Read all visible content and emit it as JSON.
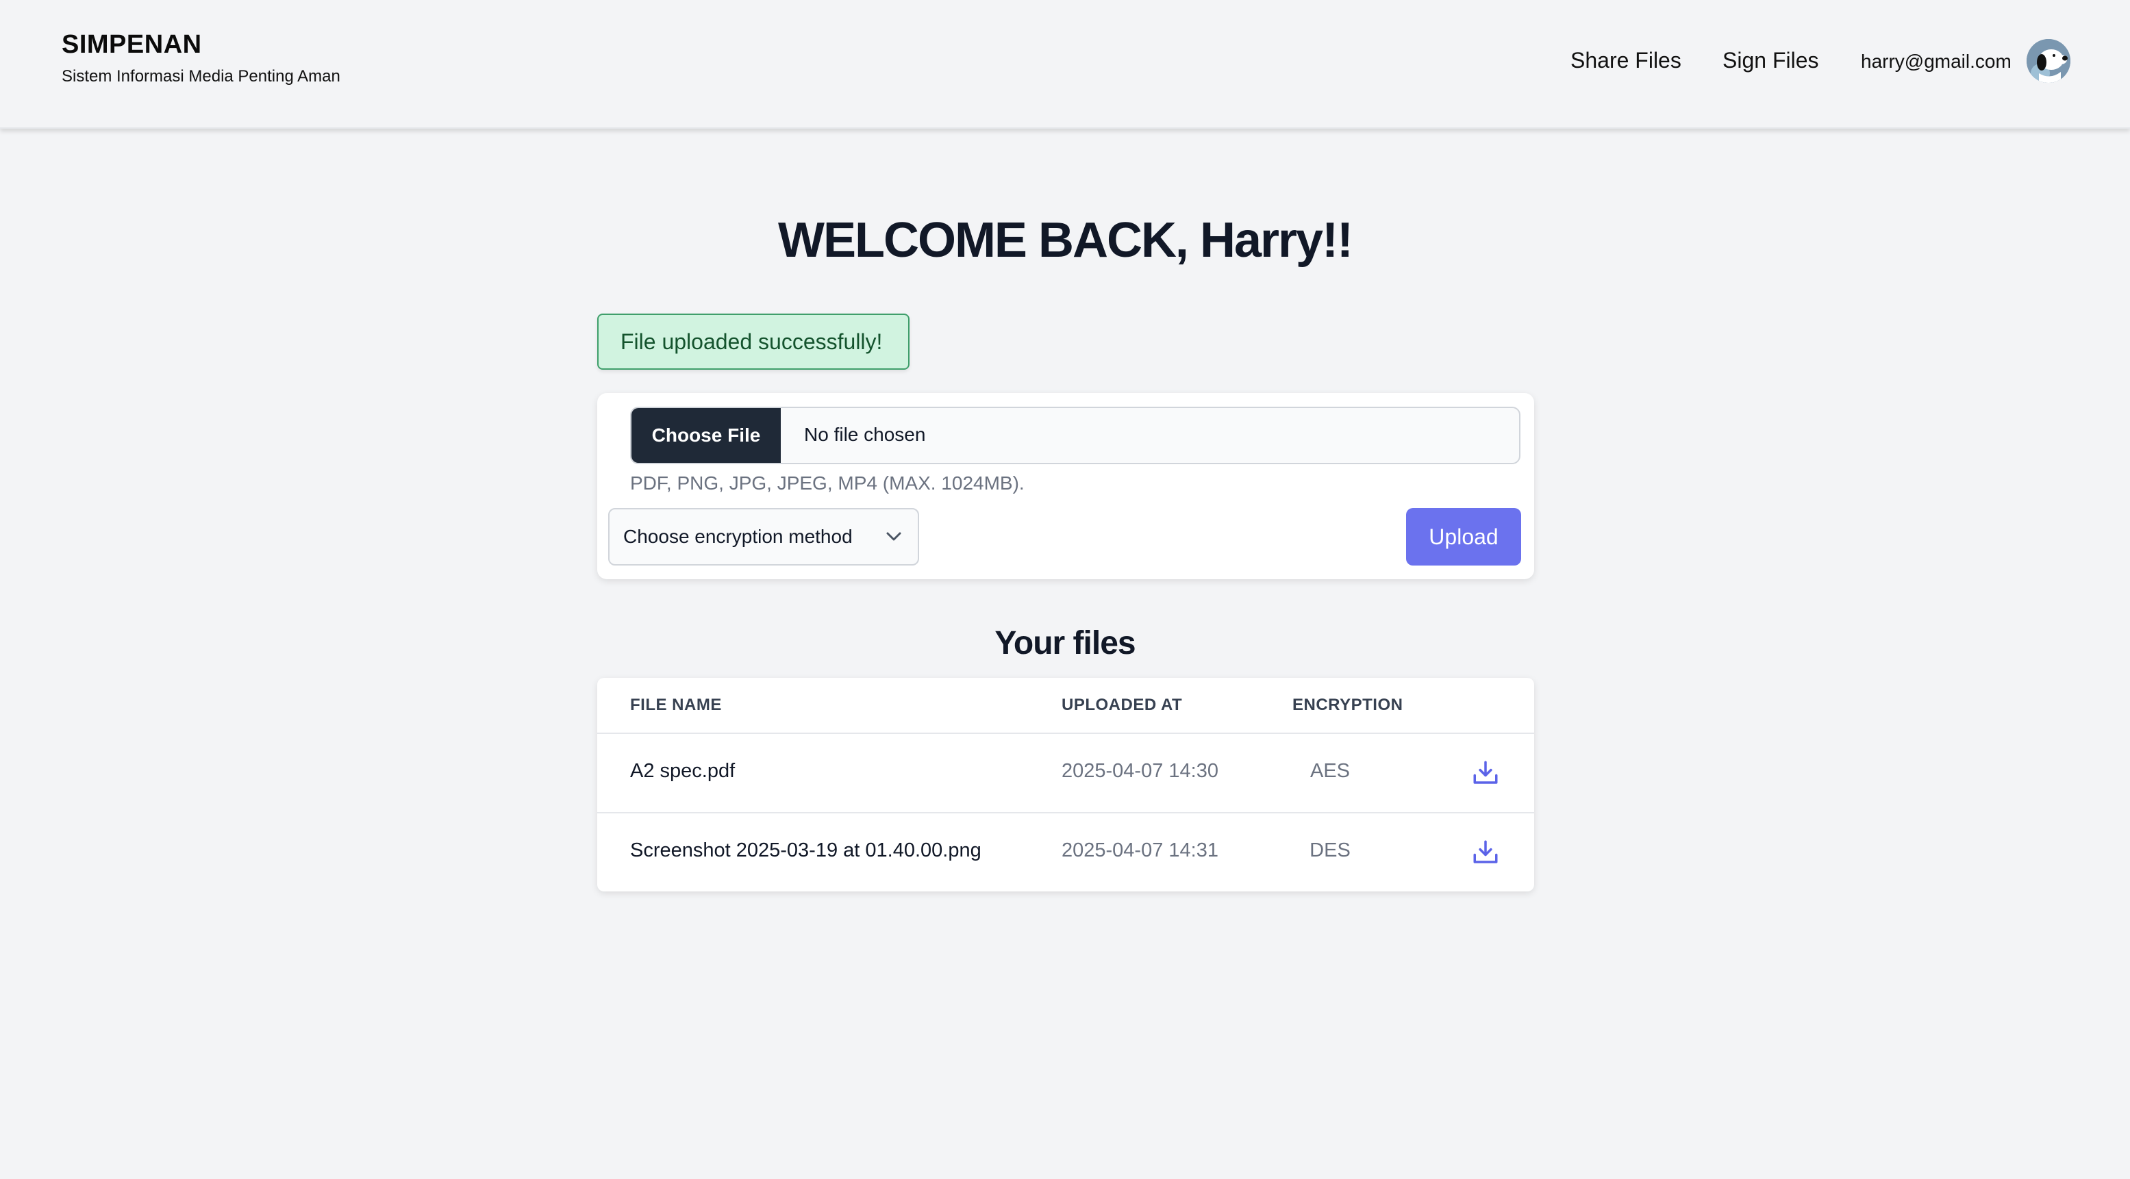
{
  "header": {
    "brand_title": "SIMPENAN",
    "brand_subtitle": "Sistem Informasi Media Penting Aman",
    "nav": {
      "share_files": "Share Files",
      "sign_files": "Sign Files"
    },
    "user_email": "harry@gmail.com"
  },
  "welcome": "WELCOME BACK, Harry!!",
  "alert": {
    "message": "File uploaded successfully!",
    "color": "#d1f3e0"
  },
  "upload": {
    "choose_file_label": "Choose File",
    "no_file_text": "No file chosen",
    "hint": "PDF, PNG, JPG, JPEG, MP4 (MAX. 1024MB).",
    "encryption_select": "Choose encryption method",
    "upload_label": "Upload",
    "accent": "#6b72ee"
  },
  "files": {
    "title": "Your files",
    "columns": {
      "name": "FILE NAME",
      "uploaded_at": "UPLOADED AT",
      "encryption": "ENCRYPTION"
    },
    "rows": [
      {
        "name": "A2 spec.pdf",
        "uploaded_at": "2025-04-07 14:30",
        "encryption": "AES",
        "action_icon": "download-icon"
      },
      {
        "name": "Screenshot 2025-03-19 at 01.40.00.png",
        "uploaded_at": "2025-04-07 14:31",
        "encryption": "DES",
        "action_icon": "download-icon"
      }
    ]
  }
}
